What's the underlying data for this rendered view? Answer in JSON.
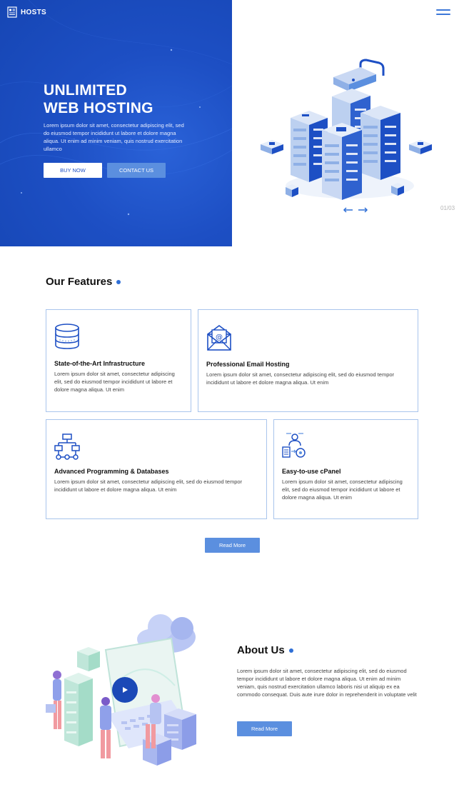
{
  "header": {
    "logo_text": "HOSTS",
    "menu_icon": "hamburger-menu-icon"
  },
  "hero": {
    "title_line1": "UNLIMITED",
    "title_line2": "WEB HOSTING",
    "text": "Lorem ipsum dolor sit amet, consectetur adipiscing elit, sed do eiusmod tempor incididunt ut labore et dolore magna aliqua. Ut enim ad minim veniam, quis nostrud exercitation ullamco",
    "buy_label": "BUY NOW",
    "contact_label": "CONTACT US",
    "slide_counter": "01/03"
  },
  "features": {
    "title": "Our Features",
    "items": [
      {
        "icon": "database-icon",
        "title": "State-of-the-Art Infrastructure",
        "text": "Lorem ipsum dolor sit amet, consectetur adipiscing elit, sed do eiusmod tempor incididunt ut labore et dolore magna aliqua. Ut enim"
      },
      {
        "icon": "email-envelope-icon",
        "title": "Professional Email Hosting",
        "text": "Lorem ipsum dolor sit amet, consectetur adipiscing elit, sed do eiusmod tempor incididunt ut labore et dolore magna aliqua. Ut enim"
      },
      {
        "icon": "flowchart-icon",
        "title": "Advanced Programming & Databases",
        "text": "Lorem ipsum dolor sit amet, consectetur adipiscing elit, sed do eiusmod tempor incididunt ut labore et dolore magna aliqua. Ut enim"
      },
      {
        "icon": "control-panel-user-icon",
        "title": "Easy-to-use cPanel",
        "text": "Lorem ipsum dolor sit amet, consectetur adipiscing elit, sed do eiusmod tempor incididunt ut labore et dolore magna aliqua. Ut enim"
      }
    ],
    "read_more_label": "Read More"
  },
  "about": {
    "title": "About Us",
    "text": "Lorem ipsum dolor sit amet, consectetur adipiscing elit, sed do eiusmod tempor incididunt ut labore et dolore magna aliqua. Ut enim ad minim veniam, quis nostrud exercitation ullamco laboris nisi ut aliquip ex ea commodo consequat. Duis aute irure dolor in reprehenderit in voluptate velit",
    "read_more_label": "Read More",
    "play_icon": "play-icon"
  },
  "colors": {
    "hero_blue": "#1d4fc4",
    "accent": "#5b8fdf",
    "card_border": "#a9c5ec",
    "dark_blue": "#1b49b7"
  }
}
